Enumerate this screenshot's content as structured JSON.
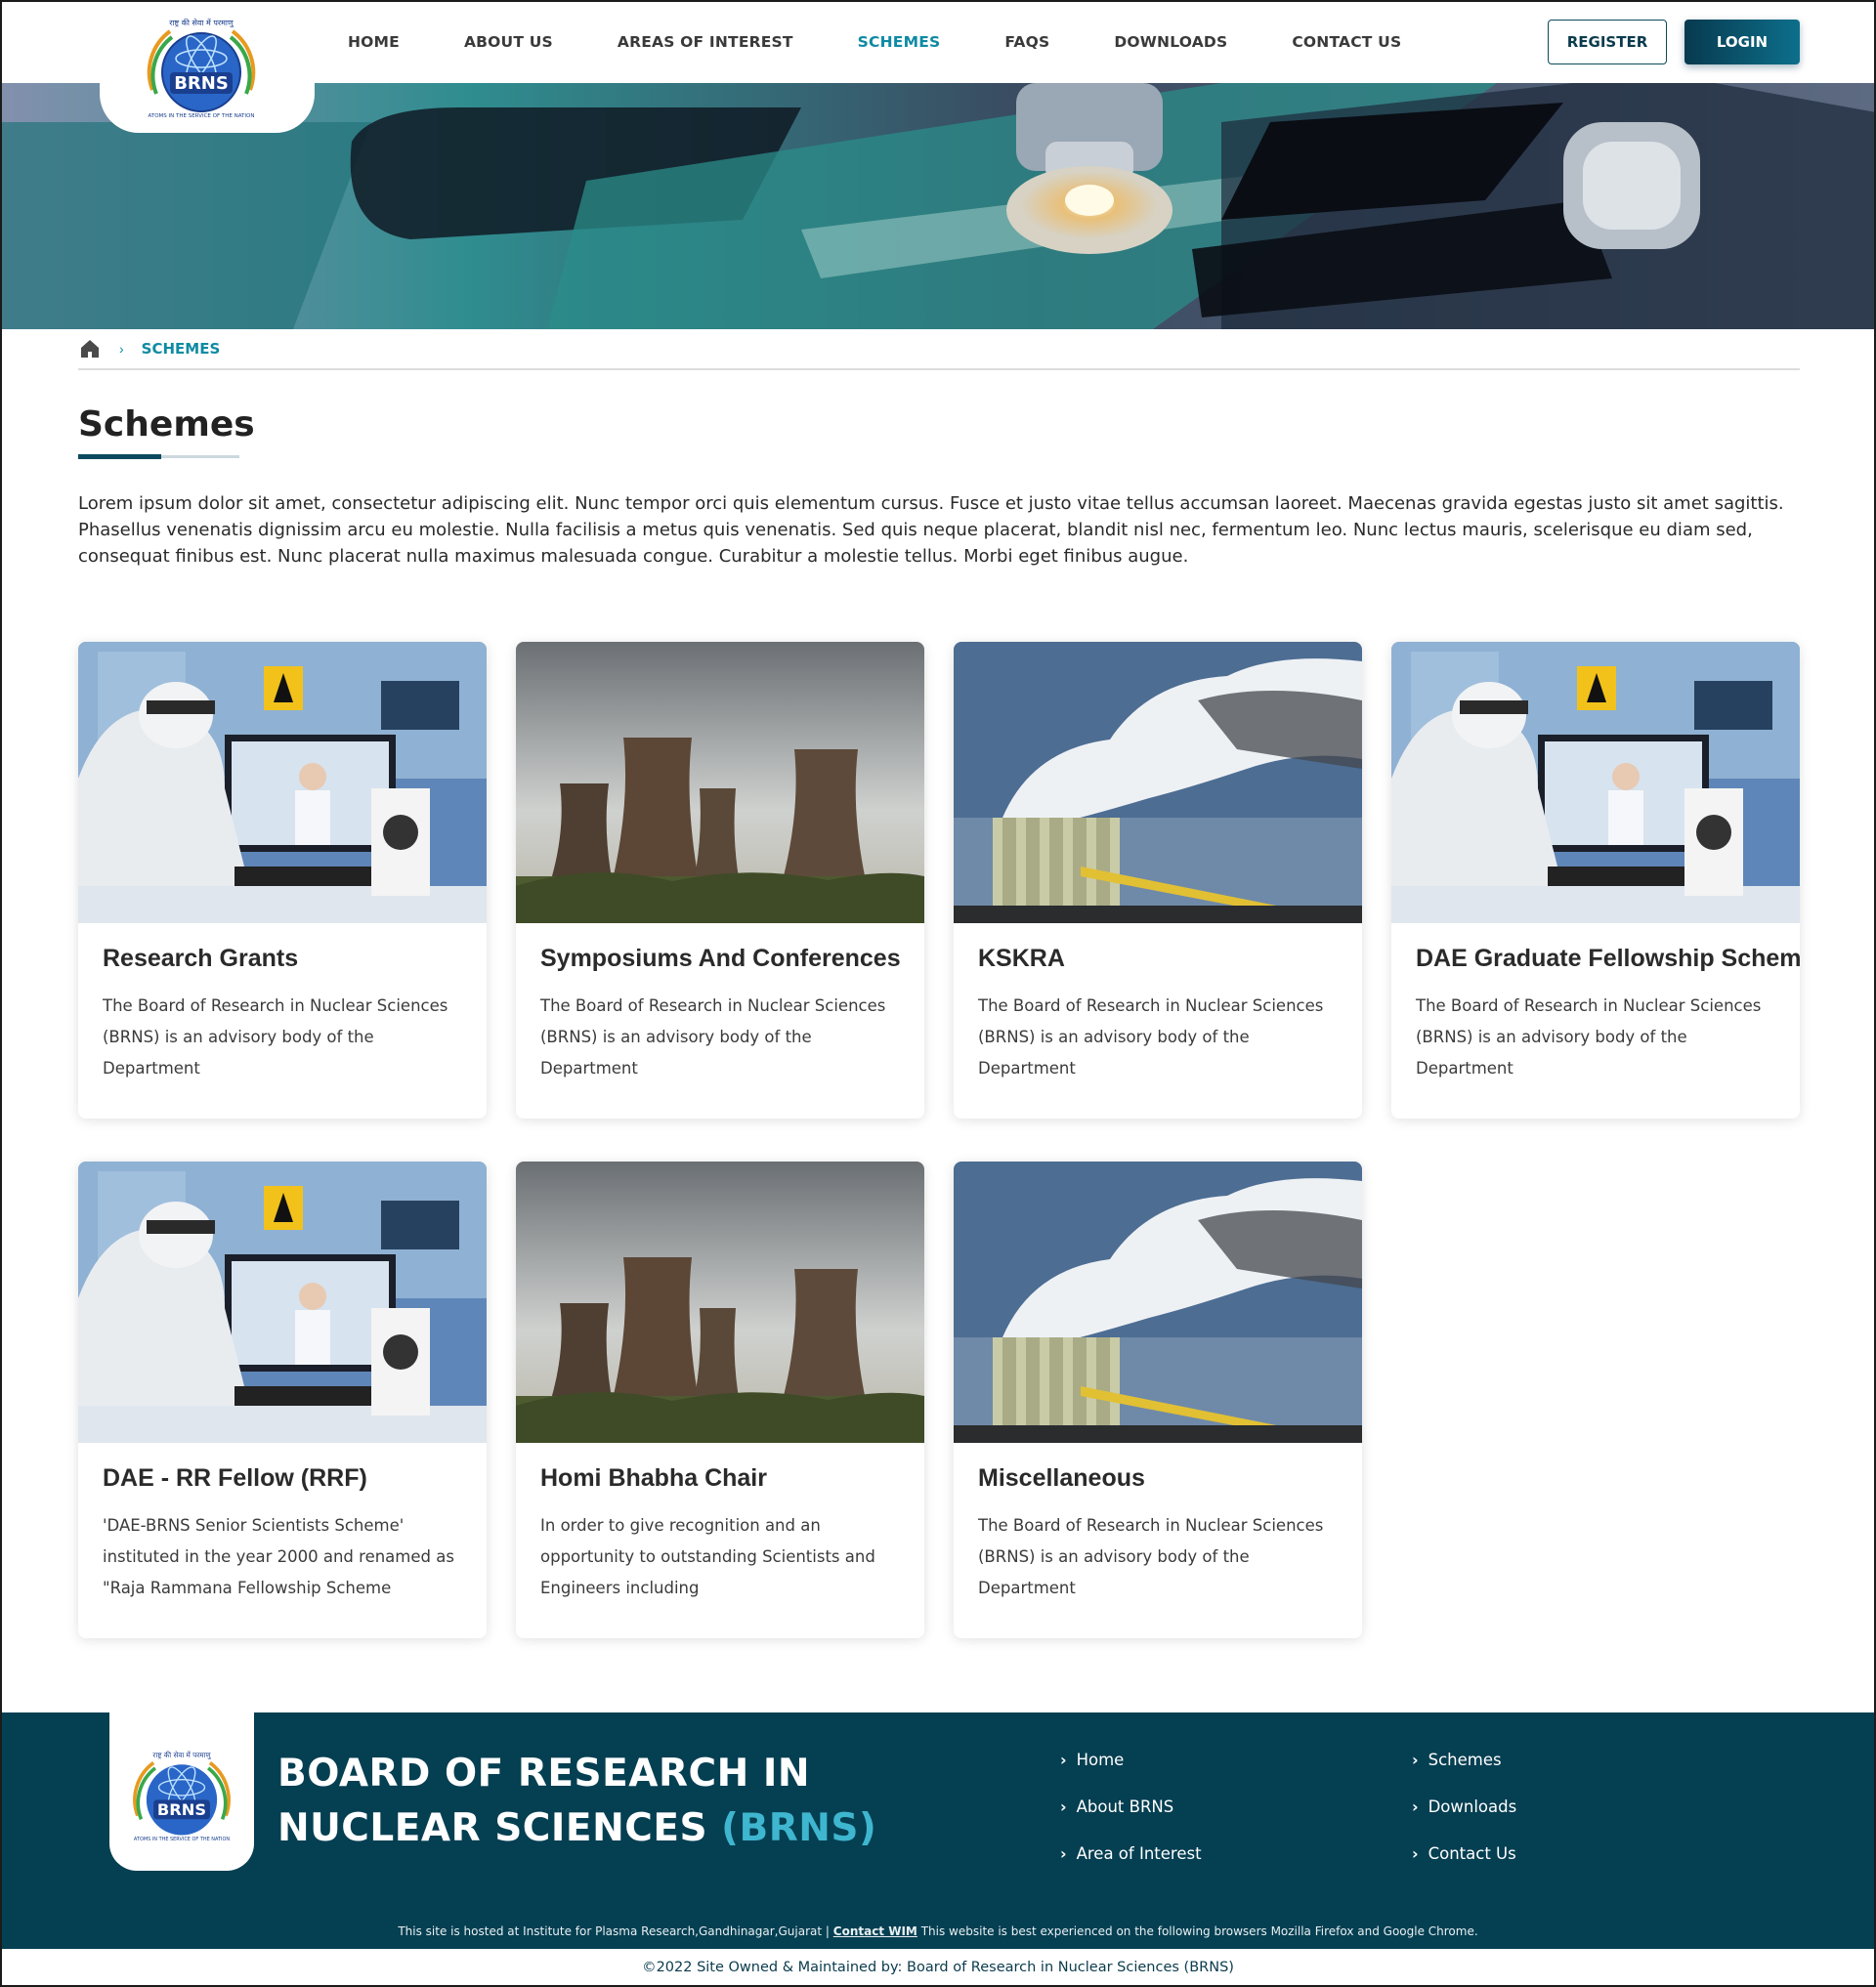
{
  "header": {
    "logo_text": "BRNS",
    "logo_ring_text": "राष्ट्र की सेवा में परमाणु · ATOMS IN THE SERVICE OF THE NATION",
    "nav": [
      "HOME",
      "ABOUT US",
      "AREAS OF INTEREST",
      "SCHEMES",
      "FAQS",
      "DOWNLOADS",
      "CONTACT US"
    ],
    "active_nav": "SCHEMES",
    "register_label": "REGISTER",
    "login_label": "LOGIN"
  },
  "breadcrumb": {
    "home_icon": "home-icon",
    "current": "SCHEMES"
  },
  "page": {
    "title": "Schemes",
    "intro": "Lorem ipsum dolor sit amet, consectetur adipiscing elit. Nunc tempor orci quis elementum cursus. Fusce et justo vitae tellus accumsan laoreet. Maecenas gravida egestas justo sit amet sagittis. Phasellus venenatis dignissim arcu eu molestie. Nulla facilisis a metus quis venenatis. Sed quis neque placerat, blandit nisl nec, fermentum leo. Nunc lectus mauris, scelerisque eu diam sed, consequat finibus est. Nunc placerat nulla maximus malesuada congue. Curabitur a molestie tellus. Morbi eget finibus augue."
  },
  "cards": [
    {
      "title": "Research Grants",
      "desc": "The Board of Research in Nuclear Sciences (BRNS) is an advisory body of the Department",
      "image": "lab-scientist-image"
    },
    {
      "title": "Symposiums And Conferences",
      "desc": "The Board of Research in Nuclear Sciences (BRNS) is an advisory body of the Department",
      "image": "cooling-towers-image"
    },
    {
      "title": "KSKRA",
      "desc": "The Board of Research in Nuclear Sciences (BRNS) is an advisory body of the Department",
      "image": "smokestack-image"
    },
    {
      "title": "DAE Graduate Fellowship Scheme",
      "desc": "The Board of Research in Nuclear Sciences (BRNS) is an advisory body of the Department",
      "image": "lab-scientist-image"
    },
    {
      "title": "DAE - RR Fellow (RRF)",
      "desc": "'DAE-BRNS Senior Scientists Scheme' instituted in the year 2000 and renamed as \"Raja Rammana Fellowship Scheme",
      "image": "lab-scientist-image"
    },
    {
      "title": "Homi Bhabha Chair",
      "desc": "In order to give recognition and an opportunity to outstanding Scientists and Engineers including",
      "image": "cooling-towers-image"
    },
    {
      "title": "Miscellaneous",
      "desc": "The Board of Research in Nuclear Sciences (BRNS) is an advisory body of the Department",
      "image": "smokestack-image"
    }
  ],
  "footer": {
    "org_line1": "BOARD OF RESEARCH IN",
    "org_line2": "NUCLEAR SCIENCES",
    "org_abbr": "(BRNS)",
    "links_col1": [
      "Home",
      "About BRNS",
      "Area of Interest"
    ],
    "links_col2": [
      "Schemes",
      "Downloads",
      "Contact Us"
    ],
    "note_prefix": "This site is hosted at Institute for Plasma Research,Gandhinagar,Gujarat  |",
    "note_link": "Contact WIM",
    "note_suffix": "This website is best experienced on the following browsers Mozilla Firefox and Google Chrome.",
    "copyright": "©2022 Site Owned & Maintained by: Board of Research in Nuclear Sciences (BRNS)"
  },
  "colors": {
    "primary": "#053f52",
    "accent": "#0f8aa3",
    "abbr": "#3fb6cf"
  }
}
